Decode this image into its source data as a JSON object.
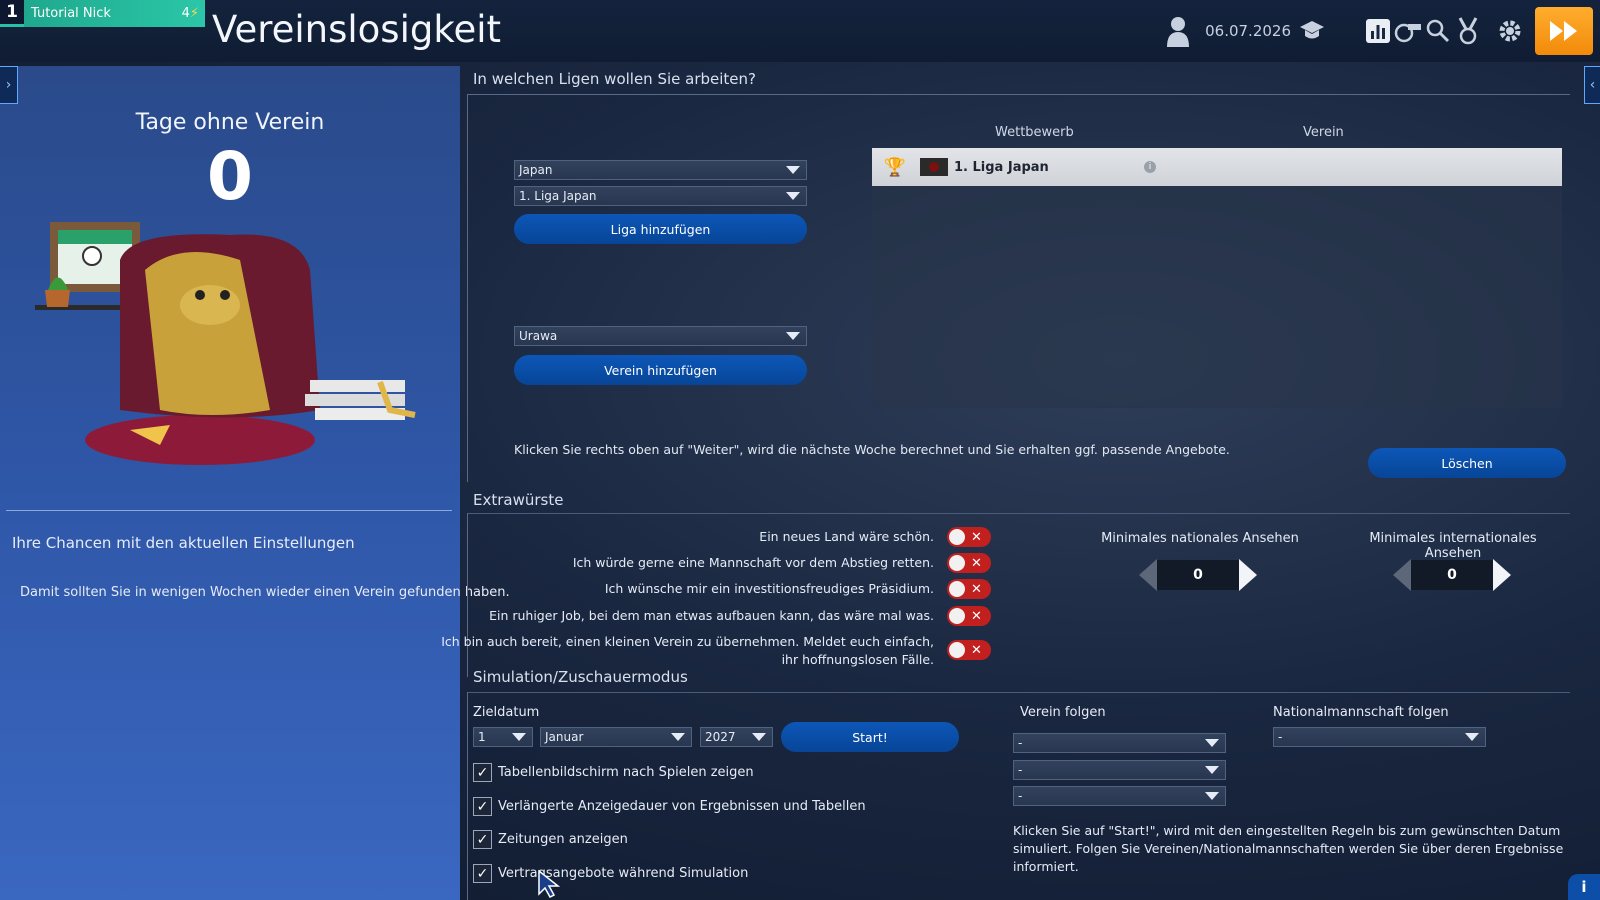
{
  "manager": {
    "slot": "1",
    "name": "Tutorial Nick",
    "energy": "4"
  },
  "page": {
    "title": "Vereinslosigkeit"
  },
  "topbar": {
    "date": "06.07.2026"
  },
  "left": {
    "days_label": "Tage ohne Verein",
    "days_value": "0",
    "chances_title": "Ihre Chancen mit den aktuellen Einstellungen",
    "chances_text": "Damit sollten Sie in wenigen Wochen wieder einen Verein gefunden haben."
  },
  "leagues": {
    "heading": "In welchen Ligen wollen Sie arbeiten?",
    "country_select": "Japan",
    "league_select": "1. Liga Japan",
    "add_league_label": "Liga hinzufügen",
    "club_select": "Urawa",
    "add_club_label": "Verein hinzufügen",
    "col_competition": "Wettbewerb",
    "col_club": "Verein",
    "rows": [
      {
        "competition": "1. Liga Japan",
        "club": ""
      }
    ],
    "hint": "Klicken Sie rechts oben auf \"Weiter\", wird die nächste Woche berechnet und Sie erhalten ggf. passende Angebote.",
    "delete_label": "Löschen"
  },
  "extras": {
    "heading": "Extrawürste",
    "prefs": [
      {
        "label": "Ein neues Land wäre schön.",
        "enabled": false
      },
      {
        "label": "Ich würde gerne eine Mannschaft vor dem Abstieg retten.",
        "enabled": false
      },
      {
        "label": "Ich wünsche mir ein investitionsfreudiges Präsidium.",
        "enabled": false
      },
      {
        "label": "Ein ruhiger Job, bei dem man etwas aufbauen kann, das wäre mal was.",
        "enabled": false
      },
      {
        "label_line1": "Ich bin auch bereit, einen kleinen Verein zu übernehmen. Meldet euch einfach,",
        "label_line2": "ihr hoffnungslosen Fälle.",
        "enabled": false
      }
    ],
    "min_national_label": "Minimales nationales Ansehen",
    "min_national_value": "0",
    "min_international_label": "Minimales internationales Ansehen",
    "min_international_value": "0"
  },
  "simulation": {
    "heading": "Simulation/Zuschauermodus",
    "target_date_label": "Zieldatum",
    "day": "1",
    "month": "Januar",
    "year": "2027",
    "start_label": "Start!",
    "options": [
      {
        "label": "Tabellenbildschirm nach Spielen zeigen",
        "checked": true
      },
      {
        "label": "Verlängerte Anzeigedauer von Ergebnissen und Tabellen",
        "checked": true
      },
      {
        "label": "Zeitungen anzeigen",
        "checked": true
      },
      {
        "label": "Vertragsangebote während Simulation",
        "checked": true
      }
    ],
    "follow_club_label": "Verein folgen",
    "follow_club_values": [
      "-",
      "-",
      "-"
    ],
    "follow_nation_label": "Nationalmannschaft folgen",
    "follow_nation_value": "-",
    "note": "Klicken Sie auf \"Start!\", wird mit den eingestellten Regeln bis zum gewünschten Datum simuliert. Folgen Sie Vereinen/Nationalmannschaften werden Sie über deren Ergebnisse informiert."
  },
  "icons": {
    "profile": "person-icon",
    "academy": "graduation-cap-icon",
    "stats": "bar-chart-icon",
    "training": "whistle-icon",
    "search": "search-icon",
    "awards": "medal-icon",
    "settings": "gear-icon",
    "forward": "fast-forward-icon",
    "info": "info-icon"
  },
  "colors": {
    "accent_orange": "#f5950f",
    "toggle_off": "#c21f1f",
    "primary_button": "#0a4fa8",
    "manager_green": "#24b597"
  }
}
